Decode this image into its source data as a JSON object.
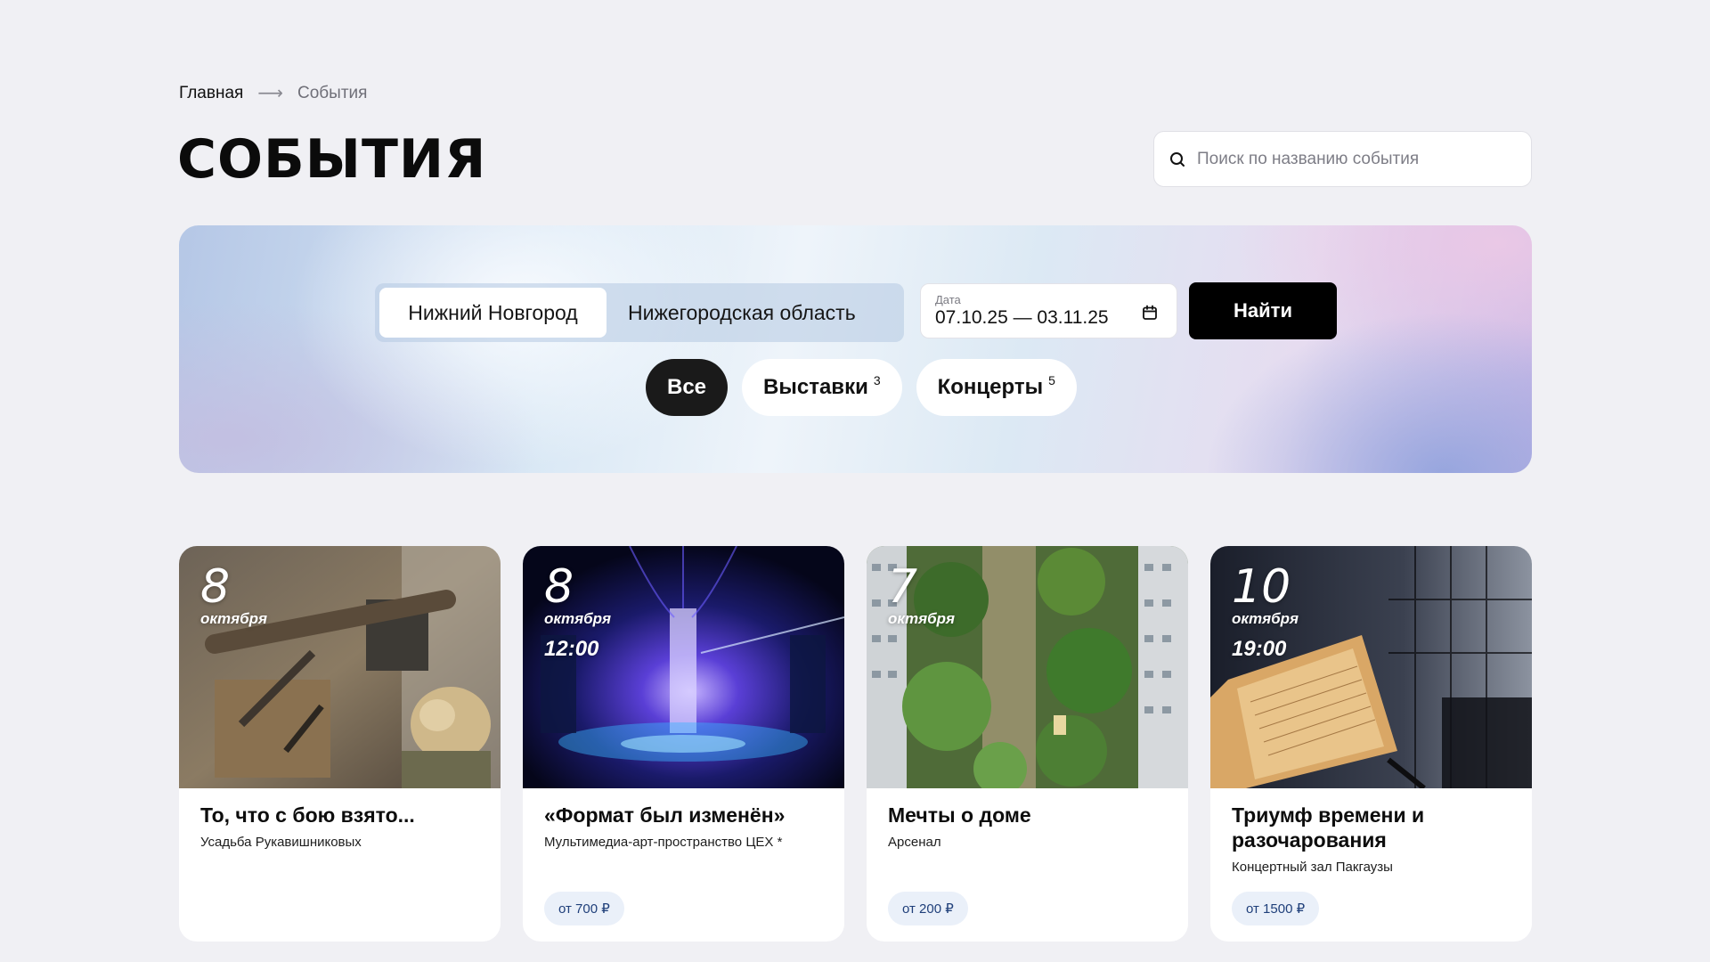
{
  "breadcrumb": {
    "home": "Главная",
    "arrow": "⟶",
    "current": "События"
  },
  "page_title": "СОБЫТИЯ",
  "search": {
    "placeholder": "Поиск по названию события"
  },
  "hero": {
    "regions": [
      "Нижний Новгород",
      "Нижегородская область"
    ],
    "date_label": "Дата",
    "date_value": "07.10.25 — 03.11.25",
    "find_button": "Найти",
    "chips": [
      {
        "label": "Все",
        "count": ""
      },
      {
        "label": "Выставки",
        "count": "3"
      },
      {
        "label": "Концерты",
        "count": "5"
      }
    ]
  },
  "events": [
    {
      "day": "8",
      "month": "октября",
      "time": "",
      "title": "То, что с бою взято...",
      "venue": "Усадьба Рукавишниковых",
      "price": ""
    },
    {
      "day": "8",
      "month": "октября",
      "time": "12:00",
      "title": "«Формат был изменён»",
      "venue": "Мультимедиа-арт-пространство ЦЕХ *",
      "price": "от 700 ₽"
    },
    {
      "day": "7",
      "month": "октября",
      "time": "",
      "title": "Мечты о доме",
      "venue": "Арсенал",
      "price": "от 200 ₽"
    },
    {
      "day": "10",
      "month": "октября",
      "time": "19:00",
      "title": "Триумф времени и разочарования",
      "venue": "Концертный зал Пакгаузы",
      "price": "от 1500 ₽"
    }
  ],
  "colors": {
    "accent": "#000000",
    "background": "#f0f0f4",
    "price_bg": "#eaf0f9",
    "price_text": "#1f3f7a"
  }
}
